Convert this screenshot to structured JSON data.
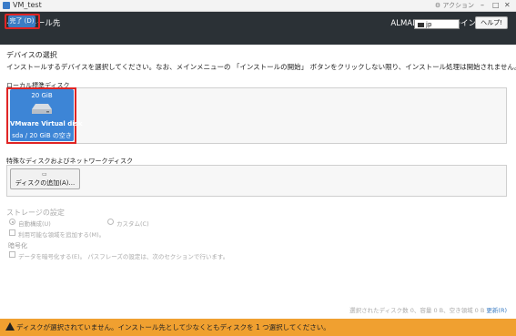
{
  "window": {
    "title": "VM_test",
    "actions_label": "アクション"
  },
  "header": {
    "title": "インストール先",
    "done_label": "完了 (D)",
    "product": "ALMALINUX 8.9 のインストール",
    "keyboard": "jp",
    "help_label": "ヘルプ!"
  },
  "device_selection": {
    "title": "デバイスの選択",
    "description": "インストールするデバイスを選択してください。なお、メインメニューの 「インストールの開始」 ボタンをクリックしない限り、インストール処理は開始されません。"
  },
  "local_disks": {
    "label": "ローカル標準ディスク",
    "disks": [
      {
        "size": "20 GiB",
        "name": "VMware Virtual disk",
        "free": "sda / 20 GiB の空き",
        "selected": true
      }
    ]
  },
  "special_disks": {
    "label": "特殊なディスクおよびネットワークディスク",
    "add_button_label": "ディスクの追加(A)..."
  },
  "storage_config": {
    "title": "ストレージの設定",
    "automatic_label": "自動構成(U)",
    "custom_label": "カスタム(C)",
    "make_space_label": "利用可能な領域を追加する(M)。",
    "encryption_title": "暗号化",
    "encrypt_label": "データを暗号化する(E)。 パスフレーズの設定は、次のセクションで行います。"
  },
  "summary": {
    "text": "選択されたディスク数 0、容量 0 B、空き領域 0 B",
    "reset_label": "更新(R)"
  },
  "warning": {
    "text": "ディスクが選択されていません。インストール先として少なくともディスクを 1 つ選択してください。"
  },
  "colors": {
    "header_bg": "#2b3136",
    "accent": "#3c7dc4",
    "highlight_outline": "#e02424",
    "warning_bg": "#f0a030"
  }
}
